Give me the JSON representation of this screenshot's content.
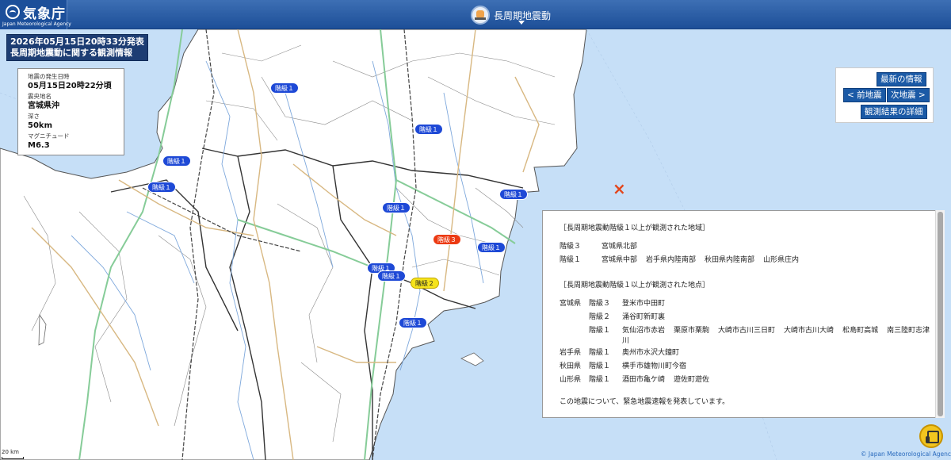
{
  "header": {
    "agency_name": "気象庁",
    "agency_name_en": "Japan Meteorological Agency",
    "center_title": "長周期地震動"
  },
  "issue": {
    "line1": "2026年05月15日20時33分発表",
    "line2": "長周期地震動に関する観測情報"
  },
  "quake": {
    "time_label": "地震の発生日時",
    "time": "05月15日20時22分頃",
    "place_label": "震央地名",
    "place": "宮城県沖",
    "depth_label": "深さ",
    "depth": "50km",
    "mag_label": "マグニチュード",
    "mag": "M6.3"
  },
  "nav": {
    "latest": "最新の情報",
    "prev": "< 前地震",
    "next": "次地震 >",
    "details": "観測結果の詳細"
  },
  "info": {
    "areas_heading": "［長周期地震動階級１以上が観測された地域］",
    "areas": [
      {
        "level": "階級３",
        "names": [
          "宮城県北部"
        ]
      },
      {
        "level": "階級１",
        "names": [
          "宮城県中部",
          "岩手県内陸南部",
          "秋田県内陸南部",
          "山形県庄内"
        ]
      }
    ],
    "points_heading": "［長周期地震動階級１以上が観測された地点］",
    "points": [
      {
        "pref": "宮城県",
        "level": "階級３",
        "names": [
          "登米市中田町"
        ]
      },
      {
        "pref": "",
        "level": "階級２",
        "names": [
          "涌谷町新町裏"
        ]
      },
      {
        "pref": "",
        "level": "階級１",
        "names": [
          "気仙沼市赤岩",
          "栗原市栗駒",
          "大崎市古川三日町",
          "大崎市古川大崎",
          "松島町高城",
          "南三陸町志津川"
        ]
      },
      {
        "pref": "岩手県",
        "level": "階級１",
        "names": [
          "奥州市水沢大鐘町"
        ]
      },
      {
        "pref": "秋田県",
        "level": "階級１",
        "names": [
          "横手市雄物川町今宿"
        ]
      },
      {
        "pref": "山形県",
        "level": "階級１",
        "names": [
          "酒田市亀ケ崎",
          "遊佐町遊佐"
        ]
      }
    ],
    "footer": "この地震について、緊急地震速報を発表しています。"
  },
  "map": {
    "badges": [
      "階級１",
      "階級１",
      "階級１",
      "階級１",
      "階級１",
      "階級１",
      "階級３",
      "階級１",
      "階級１",
      "階級１",
      "階級２",
      "階級１"
    ],
    "scale": "20 km",
    "credit": "© Japan Meteorological Agency"
  },
  "colors": {
    "header": "#1d4f98",
    "sea": "#c6dff7",
    "land": "#ffffff",
    "level1": "#1e49d6",
    "level2": "#f5e31c",
    "level3": "#ec3a12",
    "epicenter": "#e3461c"
  }
}
